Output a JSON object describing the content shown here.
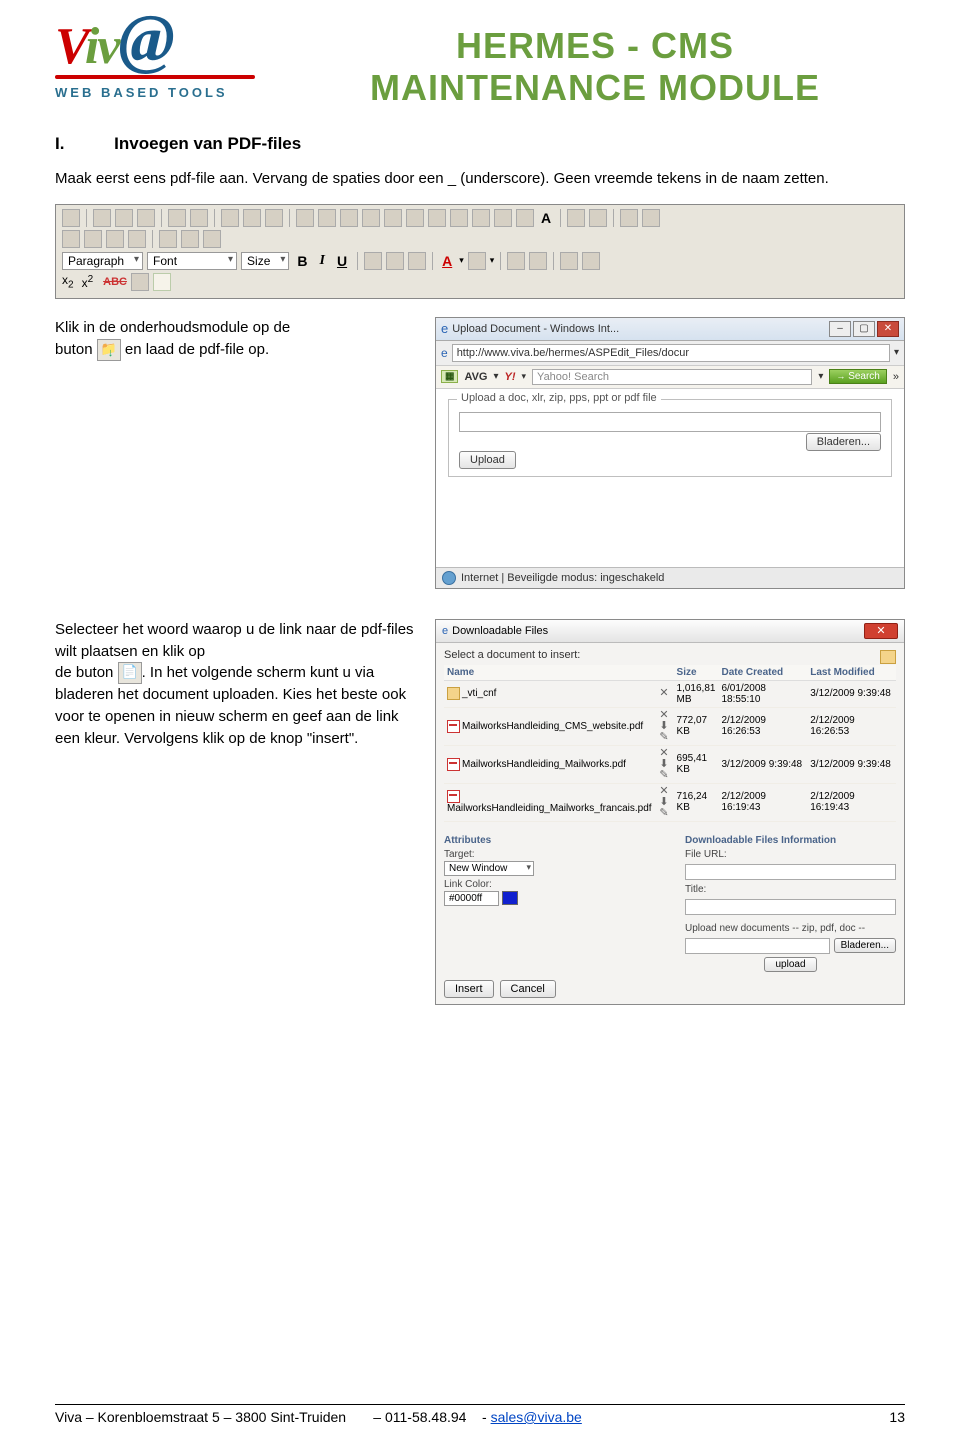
{
  "header": {
    "logo_main_v": "V",
    "logo_main_iv": "iv",
    "logo_at": "@",
    "logo_sub": "WEB BASED TOOLS",
    "title_line1": "HERMES - CMS",
    "title_line2": "MAINTENANCE MODULE"
  },
  "section": {
    "number": "I.",
    "title": "Invoegen van PDF-files"
  },
  "para1": "Maak eerst eens pdf-file aan. Vervang de spaties door een _ (underscore). Geen vreemde tekens in de naam zetten.",
  "toolbar": {
    "sel_paragraph": "Paragraph",
    "sel_font": "Font",
    "sel_size": "Size"
  },
  "para2_a": "Klik in de onderhoudsmodule op de",
  "para2_b": "buton",
  "para2_c": "en laad de pdf-file op.",
  "upload_win": {
    "title": "Upload Document - Windows Int...",
    "url": "http://www.viva.be/hermes/ASPEdit_Files/docur",
    "avg": "AVG",
    "search_placeholder": "Yahoo! Search",
    "search_btn": "Search",
    "more": "»",
    "group_label": "Upload a doc, xlr, zip, pps, ppt or pdf file",
    "browse": "Bladeren...",
    "upload": "Upload",
    "status": "Internet | Beveiligde modus: ingeschakeld"
  },
  "para3_a": "Selecteer het woord waarop u de link naar de pdf-files wilt plaatsen en klik op",
  "para3_b": "de buton",
  "para3_c": ". In het volgende scherm kunt u via bladeren het document uploaden. Kies het beste ook voor te openen in nieuw scherm en geef aan de link een kleur. Vervolgens klik op de knop \"insert\".",
  "dfw": {
    "title": "Downloadable Files",
    "select_label": "Select a document to insert:",
    "cols": {
      "name": "Name",
      "size": "Size",
      "created": "Date Created",
      "modified": "Last Modified"
    },
    "rows": [
      {
        "icon": "folder",
        "name": "_vti_cnf",
        "size1": "1,016,81",
        "size2": "MB",
        "created": "6/01/2008 18:55:10",
        "modified": "3/12/2009 9:39:48"
      },
      {
        "icon": "pdf",
        "name": "MailworksHandleiding_CMS_website.pdf",
        "size1": "772,07",
        "size2": "KB",
        "created": "2/12/2009 16:26:53",
        "modified": "2/12/2009 16:26:53"
      },
      {
        "icon": "pdf",
        "name": "MailworksHandleiding_Mailworks.pdf",
        "size1": "695,41",
        "size2": "KB",
        "created": "3/12/2009 9:39:48",
        "modified": "3/12/2009 9:39:48"
      },
      {
        "icon": "pdf",
        "name": "MailworksHandleiding_Mailworks_francais.pdf",
        "size1": "716,24",
        "size2": "KB",
        "created": "2/12/2009 16:19:43",
        "modified": "2/12/2009 16:19:43"
      }
    ],
    "attrs_label": "Attributes",
    "target_label": "Target:",
    "target_val": "New Window",
    "linkcolor_label": "Link Color:",
    "linkcolor_val": "#0000ff",
    "info_label": "Downloadable Files Information",
    "fileurl_label": "File URL:",
    "title_label": "Title:",
    "upload_label": "Upload new documents -- zip, pdf, doc --",
    "browse": "Bladeren...",
    "upload_btn": "upload",
    "insert": "Insert",
    "cancel": "Cancel"
  },
  "footer": {
    "addr": "Viva – Korenbloemstraat 5 – 3800 Sint-Truiden",
    "tel": "– 011-58.48.94",
    "sep": "- ",
    "email": "sales@viva.be",
    "page": "13"
  }
}
